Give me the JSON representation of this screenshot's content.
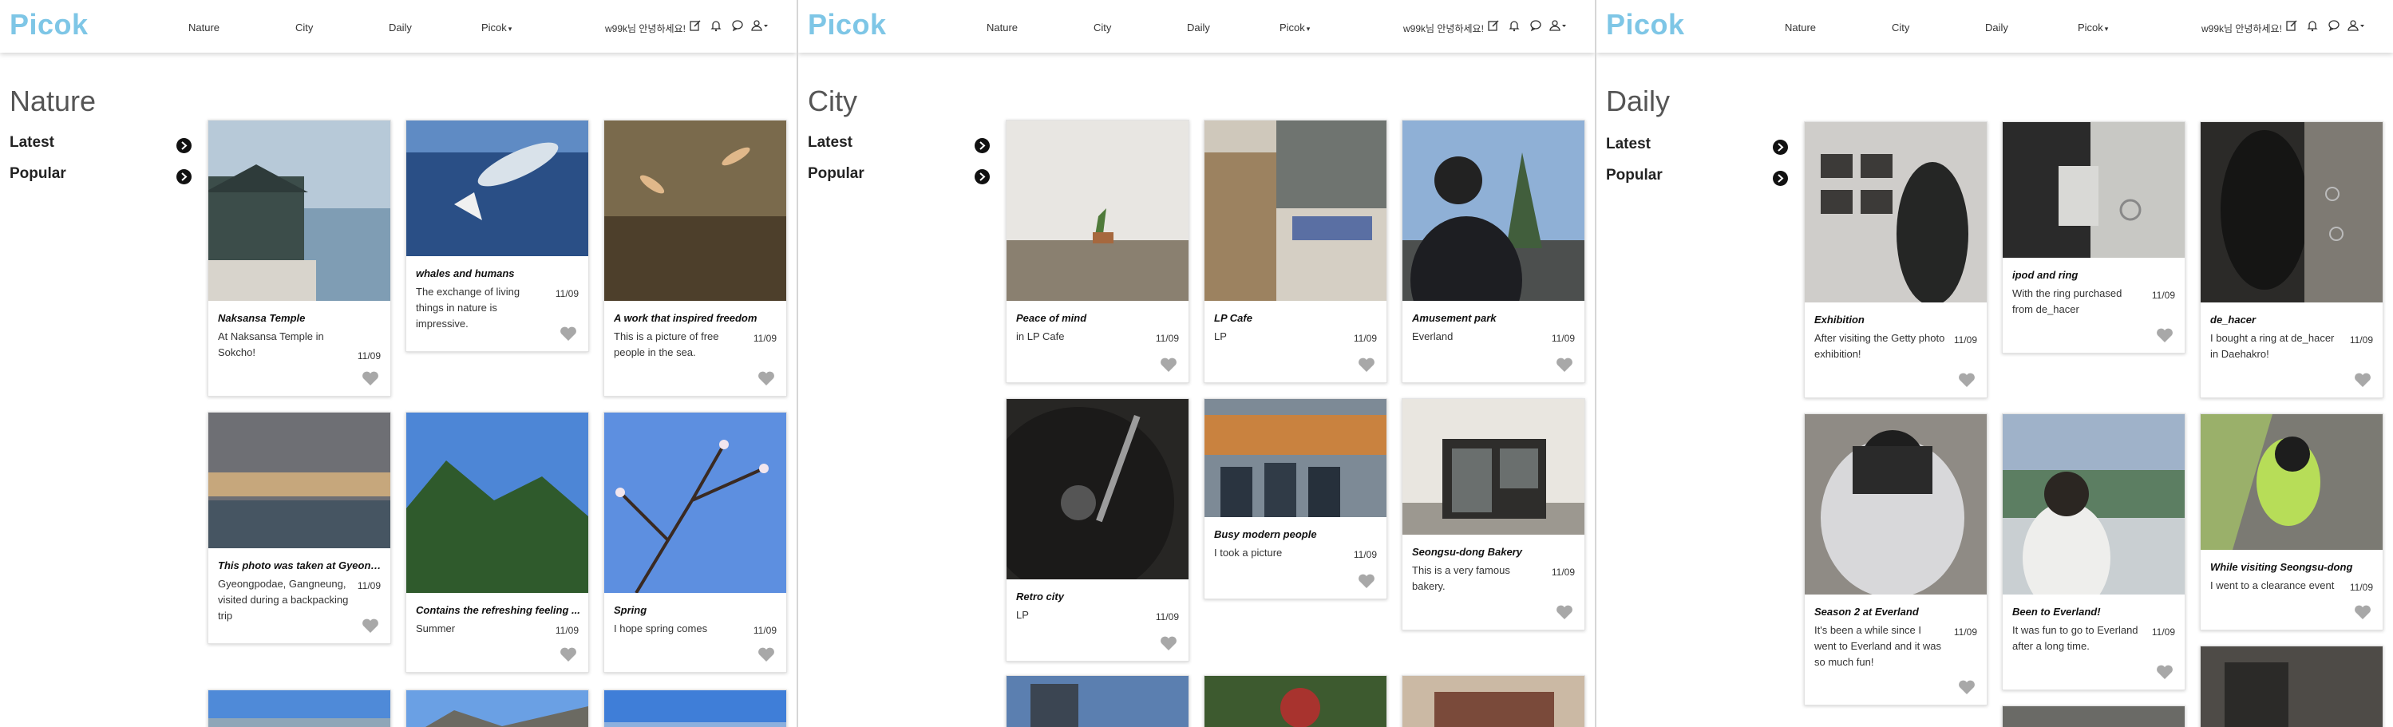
{
  "colors": {
    "brand": "#7ec6e6",
    "heart": "#a8a8a8",
    "arrow": "#111111"
  },
  "nav": {
    "brand": "Picok",
    "links": [
      "Nature",
      "City",
      "Daily"
    ],
    "dropdown": "Picok",
    "greeting": "w99k님 안녕하세요!",
    "icons": [
      "edit-icon",
      "bell-icon",
      "chat-icon",
      "user-icon"
    ]
  },
  "sidebar": {
    "latest": "Latest",
    "popular": "Popular"
  },
  "pages": [
    {
      "title": "Nature",
      "posts": [
        {
          "title": "Naksansa Temple",
          "text": "At Naksansa Temple in Sokcho!",
          "date": "11/09"
        },
        {
          "title": "whales and humans",
          "text": "The exchange of living things in nature is impressive.",
          "date": "11/09"
        },
        {
          "title": "A work that inspired freedom",
          "text": "This is a picture of free people in the sea.",
          "date": "11/09"
        },
        {
          "title": "This photo was taken at Gyeong...",
          "text": "Gyeongpodae, Gangneung, visited during a backpacking trip",
          "date": "11/09"
        },
        {
          "title": "Contains the refreshing feeling ...",
          "text": "Summer",
          "date": "11/09"
        },
        {
          "title": "Spring",
          "text": "I hope spring comes",
          "date": "11/09"
        }
      ]
    },
    {
      "title": "City",
      "posts": [
        {
          "title": "Peace of mind",
          "text": "in LP Cafe",
          "date": "11/09"
        },
        {
          "title": "LP Cafe",
          "text": "LP",
          "date": "11/09"
        },
        {
          "title": "Amusement park",
          "text": "Everland",
          "date": "11/09"
        },
        {
          "title": "Retro city",
          "text": "LP",
          "date": "11/09"
        },
        {
          "title": "Busy modern people",
          "text": "I took a picture",
          "date": "11/09"
        },
        {
          "title": "Seongsu-dong Bakery",
          "text": "This is a very famous bakery.",
          "date": "11/09"
        }
      ]
    },
    {
      "title": "Daily",
      "posts": [
        {
          "title": "Exhibition",
          "text": "After visiting the Getty photo exhibition!",
          "date": "11/09"
        },
        {
          "title": "ipod and ring",
          "text": "With the ring purchased from de_hacer",
          "date": "11/09"
        },
        {
          "title": "de_hacer",
          "text": "I bought a ring at de_hacer in Daehakro!",
          "date": "11/09"
        },
        {
          "title": "Season 2 at Everland",
          "text": "It's been a while since I went to Everland and it was so much fun!",
          "date": "11/09"
        },
        {
          "title": "Been to Everland!",
          "text": "It was fun to go to Everland after a long time.",
          "date": "11/09"
        },
        {
          "title": "While visiting Seongsu-dong",
          "text": "I went to a clearance event",
          "date": "11/09"
        }
      ]
    }
  ]
}
